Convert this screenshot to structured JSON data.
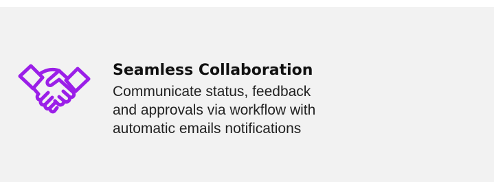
{
  "feature": {
    "icon": "handshake-icon",
    "icon_color": "#9b1fe8",
    "title": "Seamless Collaboration",
    "description_lines": [
      "Communicate status, feedback",
      "and approvals via workflow with",
      "automatic emails notifications"
    ]
  }
}
